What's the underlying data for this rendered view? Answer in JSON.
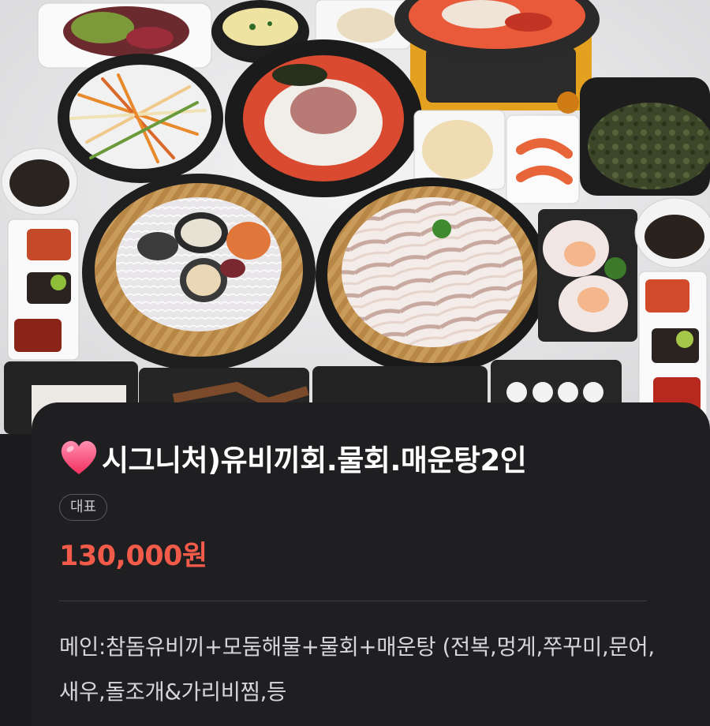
{
  "photo": {
    "alt_icon": "food-platter-image"
  },
  "item": {
    "heart_icon": "heart-icon",
    "title": "시그니처)유비끼회.물회.매운탕2인",
    "badge": "대표",
    "price": "130,000원",
    "description": "메인:참돔유비끼+모둠해물+물회+매운탕 (전복,멍게,쭈꾸미,문어,새우,돌조개&가리비찜,등"
  },
  "colors": {
    "background": "#1c1c1e",
    "sheet": "#1f1f21",
    "price": "#f25a4a",
    "heart": "#ff4f7b",
    "title": "#ffffff",
    "description": "#d6d6d9"
  }
}
